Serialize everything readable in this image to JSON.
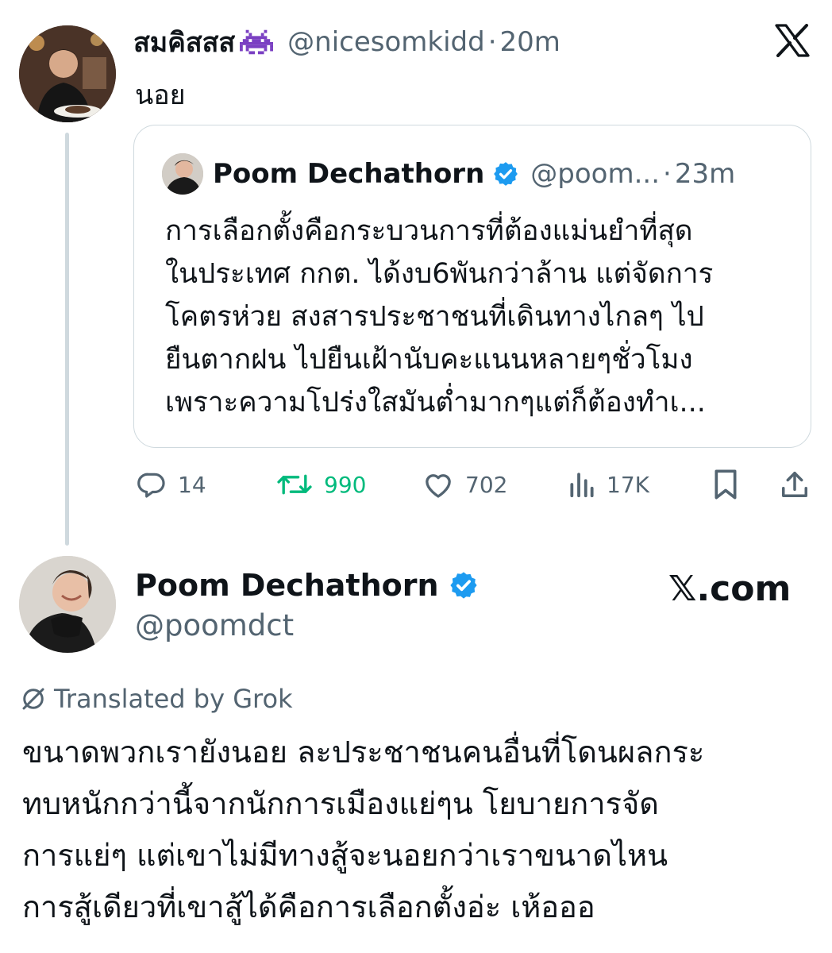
{
  "reply_tweet": {
    "display_name": "สมคิสสส",
    "name_emoji": "👾",
    "handle": "@nicesomkidd",
    "separator": "·",
    "time": "20m",
    "text": "นอย"
  },
  "quoted_tweet": {
    "display_name": "Poom Dechathorn",
    "verified": true,
    "handle": "@poom...",
    "separator": "·",
    "time": "23m",
    "lines": [
      "การเลือกตั้งคือกระบวนการที่ต้องแม่นยำที่สุด",
      "ในประเทศ กกต. ได้งบ6พันกว่าล้าน แต่จัดการ",
      "โคตรห่วย สงสารประชาชนที่เดินทางไกลๆ ไป",
      "ยืนตากฝน ไปยืนเฝ้านับคะแนนหลายๆชั่วโมง",
      "เพราะความโปร่งใสมันต่ำมากๆแต่ก็ต้องทำเ..."
    ]
  },
  "actions": {
    "replies": "14",
    "reposts": "990",
    "likes": "702",
    "views": "17K"
  },
  "main_tweet": {
    "display_name": "Poom Dechathorn",
    "verified": true,
    "handle": "@poomdct",
    "site_label": "𝕏.com",
    "translated_label": "Translated by Grok",
    "lines": [
      "ขนาดพวกเรายังนอย ละประชาชนคนอื่นที่โดนผลกระ",
      "ทบหนักกว่านี้จากนักการเมืองแย่ๆน โยบายการจัด",
      "การแย่ๆ แต่เขาไม่มีทางสู้จะนอยกว่าเราขนาดไหน",
      "การสู้เดียวที่เขาสู้ได้คือการเลือกตั้งอ่ะ เห้อออ"
    ]
  },
  "colors": {
    "verified_blue": "#1d9bf0",
    "repost_green": "#00ba7c",
    "muted_gray": "#536471",
    "border": "#cfd9de",
    "thread_line": "#cfd9de"
  },
  "icons": [
    "x-logo-icon",
    "verified-badge-icon",
    "reply-icon",
    "repost-icon",
    "like-icon",
    "views-icon",
    "bookmark-icon",
    "share-icon",
    "grok-translate-icon"
  ]
}
